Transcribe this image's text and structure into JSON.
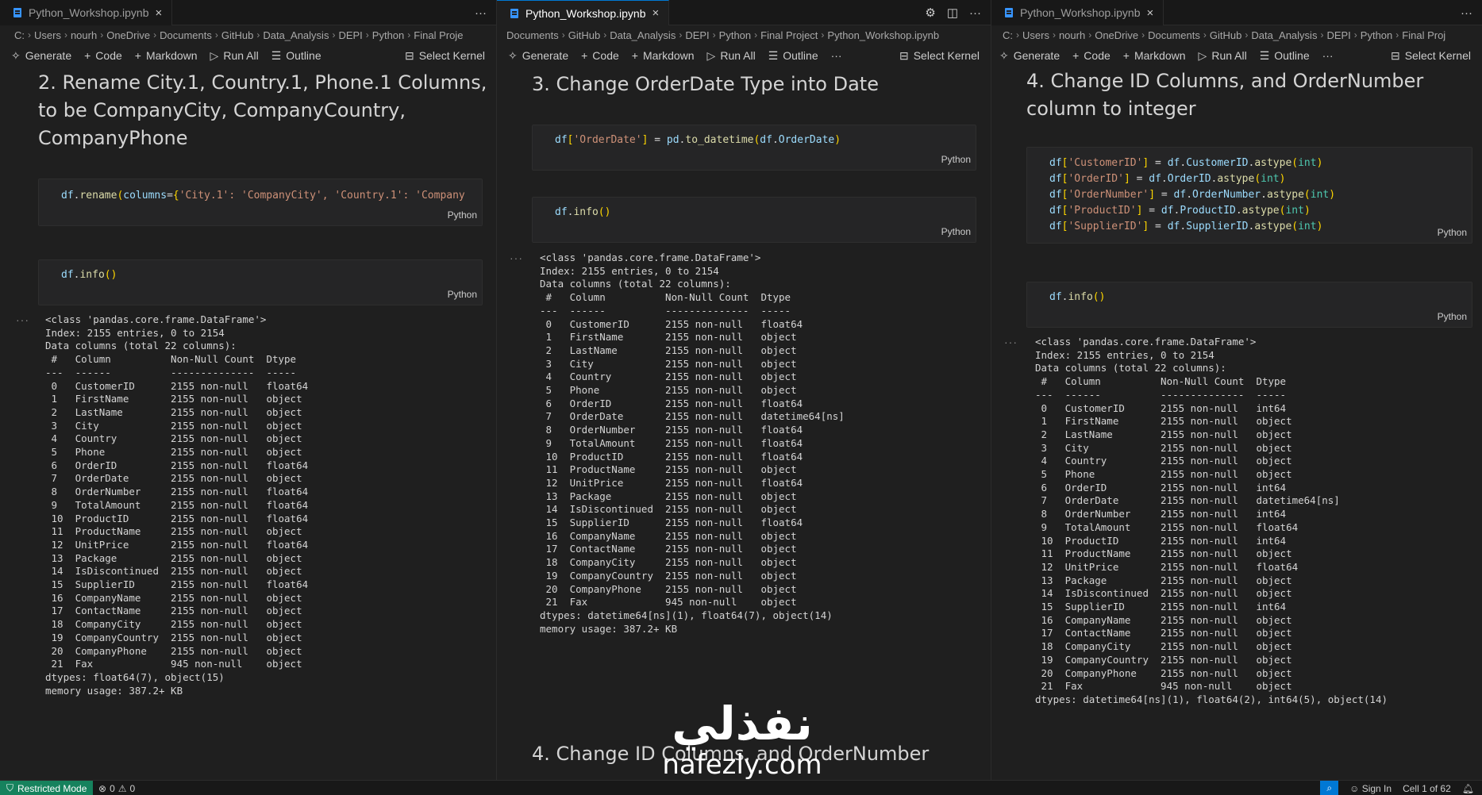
{
  "panes": [
    {
      "tab": "Python_Workshop.ipynb",
      "tab_active": false,
      "breadcrumb": [
        "C:",
        "Users",
        "nourh",
        "OneDrive",
        "Documents",
        "GitHub",
        "Data_Analysis",
        "DEPI",
        "Python",
        "Final Proje"
      ],
      "toolbar": {
        "generate": "Generate",
        "code": "Code",
        "markdown": "Markdown",
        "run_all": "Run All",
        "outline": "Outline",
        "select_kernel": "Select Kernel"
      },
      "heading": "2. Rename City.1, Country.1, Phone.1 Columns, to be CompanyCity, CompanyCountry, CompanyPhone",
      "code1": "df.rename(columns={'City.1': 'CompanyCity', 'Country.1': 'Company",
      "code2": "df.info()",
      "lang": "Python",
      "output": "<class 'pandas.core.frame.DataFrame'>\nIndex: 2155 entries, 0 to 2154\nData columns (total 22 columns):\n #   Column          Non-Null Count  Dtype  \n---  ------          --------------  -----  \n 0   CustomerID      2155 non-null   float64\n 1   FirstName       2155 non-null   object \n 2   LastName        2155 non-null   object \n 3   City            2155 non-null   object \n 4   Country         2155 non-null   object \n 5   Phone           2155 non-null   object \n 6   OrderID         2155 non-null   float64\n 7   OrderDate       2155 non-null   object \n 8   OrderNumber     2155 non-null   float64\n 9   TotalAmount     2155 non-null   float64\n 10  ProductID       2155 non-null   float64\n 11  ProductName     2155 non-null   object \n 12  UnitPrice       2155 non-null   float64\n 13  Package         2155 non-null   object \n 14  IsDiscontinued  2155 non-null   object \n 15  SupplierID      2155 non-null   float64\n 16  CompanyName     2155 non-null   object \n 17  ContactName     2155 non-null   object \n 18  CompanyCity     2155 non-null   object \n 19  CompanyCountry  2155 non-null   object \n 20  CompanyPhone    2155 non-null   object \n 21  Fax             945 non-null    object \ndtypes: float64(7), object(15)\nmemory usage: 387.2+ KB"
    },
    {
      "tab": "Python_Workshop.ipynb",
      "tab_active": true,
      "breadcrumb": [
        "Documents",
        "GitHub",
        "Data_Analysis",
        "DEPI",
        "Python",
        "Final Project",
        "Python_Workshop.ipynb"
      ],
      "toolbar": {
        "generate": "Generate",
        "code": "Code",
        "markdown": "Markdown",
        "run_all": "Run All",
        "outline": "Outline",
        "select_kernel": "Select Kernel"
      },
      "heading": "3. Change OrderDate Type into Date",
      "code1": "df['OrderDate'] = pd.to_datetime(df.OrderDate)",
      "code2": "df.info()",
      "lang": "Python",
      "output": "<class 'pandas.core.frame.DataFrame'>\nIndex: 2155 entries, 0 to 2154\nData columns (total 22 columns):\n #   Column          Non-Null Count  Dtype         \n---  ------          --------------  -----         \n 0   CustomerID      2155 non-null   float64       \n 1   FirstName       2155 non-null   object        \n 2   LastName        2155 non-null   object        \n 3   City            2155 non-null   object        \n 4   Country         2155 non-null   object        \n 5   Phone           2155 non-null   object        \n 6   OrderID         2155 non-null   float64       \n 7   OrderDate       2155 non-null   datetime64[ns]\n 8   OrderNumber     2155 non-null   float64       \n 9   TotalAmount     2155 non-null   float64       \n 10  ProductID       2155 non-null   float64       \n 11  ProductName     2155 non-null   object        \n 12  UnitPrice       2155 non-null   float64       \n 13  Package         2155 non-null   object        \n 14  IsDiscontinued  2155 non-null   object        \n 15  SupplierID      2155 non-null   float64       \n 16  CompanyName     2155 non-null   object        \n 17  ContactName     2155 non-null   object        \n 18  CompanyCity     2155 non-null   object        \n 19  CompanyCountry  2155 non-null   object        \n 20  CompanyPhone    2155 non-null   object        \n 21  Fax             945 non-null    object        \ndtypes: datetime64[ns](1), float64(7), object(14)\nmemory usage: 387.2+ KB",
      "next_heading": "4. Change ID Columns, and OrderNumber"
    },
    {
      "tab": "Python_Workshop.ipynb",
      "tab_active": false,
      "breadcrumb": [
        "C:",
        "Users",
        "nourh",
        "OneDrive",
        "Documents",
        "GitHub",
        "Data_Analysis",
        "DEPI",
        "Python",
        "Final Proj"
      ],
      "toolbar": {
        "generate": "Generate",
        "code": "Code",
        "markdown": "Markdown",
        "run_all": "Run All",
        "outline": "Outline",
        "select_kernel": "Select Kernel"
      },
      "heading": "4. Change ID Columns, and OrderNumber column to integer",
      "code_lines": [
        {
          "key": "'CustomerID'",
          "attr": "CustomerID"
        },
        {
          "key": "'OrderID'",
          "attr": "OrderID"
        },
        {
          "key": "'OrderNumber'",
          "attr": "OrderNumber"
        },
        {
          "key": "'ProductID'",
          "attr": "ProductID"
        },
        {
          "key": "'SupplierID'",
          "attr": "SupplierID"
        }
      ],
      "code2": "df.info()",
      "lang": "Python",
      "output": "<class 'pandas.core.frame.DataFrame'>\nIndex: 2155 entries, 0 to 2154\nData columns (total 22 columns):\n #   Column          Non-Null Count  Dtype         \n---  ------          --------------  -----         \n 0   CustomerID      2155 non-null   int64         \n 1   FirstName       2155 non-null   object        \n 2   LastName        2155 non-null   object        \n 3   City            2155 non-null   object        \n 4   Country         2155 non-null   object        \n 5   Phone           2155 non-null   object        \n 6   OrderID         2155 non-null   int64         \n 7   OrderDate       2155 non-null   datetime64[ns]\n 8   OrderNumber     2155 non-null   int64         \n 9   TotalAmount     2155 non-null   float64       \n 10  ProductID       2155 non-null   int64         \n 11  ProductName     2155 non-null   object        \n 12  UnitPrice       2155 non-null   float64       \n 13  Package         2155 non-null   object        \n 14  IsDiscontinued  2155 non-null   object        \n 15  SupplierID      2155 non-null   int64         \n 16  CompanyName     2155 non-null   object        \n 17  ContactName     2155 non-null   object        \n 18  CompanyCity     2155 non-null   object        \n 19  CompanyCountry  2155 non-null   object        \n 20  CompanyPhone    2155 non-null   object        \n 21  Fax             945 non-null    object        \ndtypes: datetime64[ns](1), float64(2), int64(5), object(14)"
    }
  ],
  "statusbar": {
    "restricted": "Restricted Mode",
    "errors": "0",
    "warnings": "0",
    "sign_in": "Sign In",
    "cell_position": "Cell 1 of 62"
  },
  "watermark": {
    "arabic": "نفذلي",
    "latin": "nafezly.com"
  },
  "colors": {
    "accent": "#0078d4",
    "restricted_bg": "#16825d",
    "editor_bg": "#1f1f1f"
  }
}
